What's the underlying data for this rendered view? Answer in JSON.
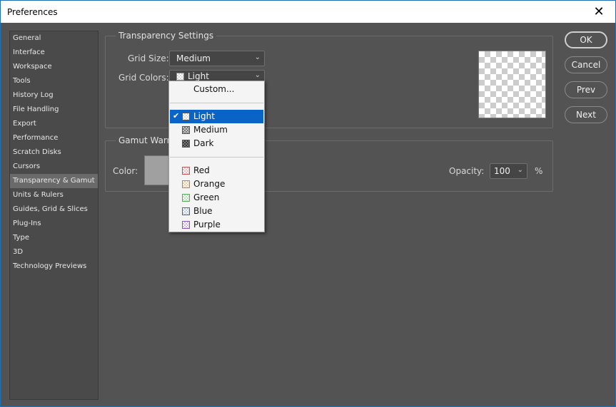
{
  "window": {
    "title": "Preferences",
    "close_glyph": "✕"
  },
  "sidebar": {
    "items": [
      {
        "label": "General"
      },
      {
        "label": "Interface"
      },
      {
        "label": "Workspace"
      },
      {
        "label": "Tools"
      },
      {
        "label": "History Log"
      },
      {
        "label": "File Handling"
      },
      {
        "label": "Export"
      },
      {
        "label": "Performance"
      },
      {
        "label": "Scratch Disks"
      },
      {
        "label": "Cursors"
      },
      {
        "label": "Transparency & Gamut"
      },
      {
        "label": "Units & Rulers"
      },
      {
        "label": "Guides, Grid & Slices"
      },
      {
        "label": "Plug-Ins"
      },
      {
        "label": "Type"
      },
      {
        "label": "3D"
      },
      {
        "label": "Technology Previews"
      }
    ],
    "selected_label": "Transparency & Gamut"
  },
  "transparency": {
    "legend": "Transparency Settings",
    "grid_size_label": "Grid Size:",
    "grid_size_value": "Medium",
    "grid_colors_label": "Grid Colors:",
    "grid_colors_value": "Light"
  },
  "gamut": {
    "legend": "Gamut Warn",
    "color_label": "Color:",
    "opacity_label": "Opacity:",
    "opacity_value": "100",
    "opacity_unit": "%"
  },
  "dropdown": {
    "custom": "Custom...",
    "light": "Light",
    "medium": "Medium",
    "dark": "Dark",
    "red": "Red",
    "orange": "Orange",
    "green": "Green",
    "blue": "Blue",
    "purple": "Purple",
    "check_glyph": "✔"
  },
  "buttons": {
    "ok": "OK",
    "cancel": "Cancel",
    "prev": "Prev",
    "next": "Next"
  },
  "colors": {
    "background": "#535353",
    "accent": "#0a64c8",
    "swatch": "#a0a0a0"
  }
}
